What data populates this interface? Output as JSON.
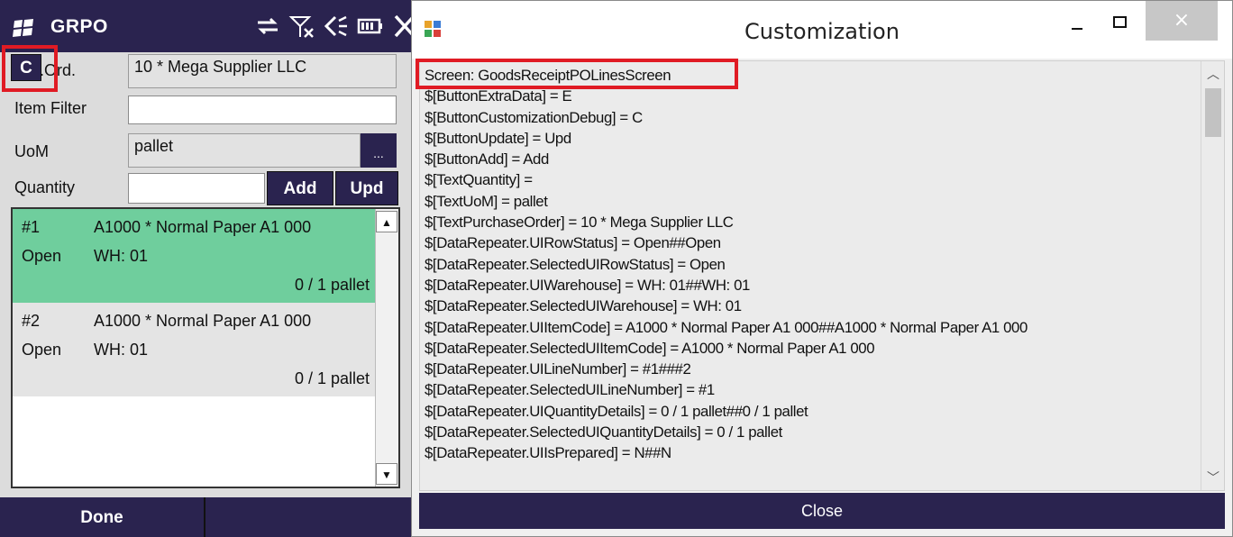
{
  "mobile": {
    "title": "GRPO",
    "debug_button": "C",
    "fields": {
      "purchase_order": {
        "label_visible": "n.Ord.",
        "value": "10 * Mega Supplier LLC"
      },
      "item_filter": {
        "label": "Item Filter",
        "value": ""
      },
      "uom": {
        "label": "UoM",
        "value": "pallet",
        "button": "..."
      },
      "quantity": {
        "label": "Quantity",
        "value": ""
      }
    },
    "buttons": {
      "add": "Add",
      "upd": "Upd",
      "done": "Done"
    },
    "rows": [
      {
        "num": "#1",
        "item": "A1000 * Normal Paper A1 000",
        "status": "Open",
        "wh": "WH: 01",
        "qty": "0 / 1 pallet",
        "selected": true
      },
      {
        "num": "#2",
        "item": "A1000 * Normal Paper A1 000",
        "status": "Open",
        "wh": "WH: 01",
        "qty": "0 / 1 pallet",
        "selected": false
      }
    ],
    "status_icons": [
      "sync-icon",
      "signal-off-icon",
      "volume-icon",
      "battery-icon",
      "close-icon"
    ]
  },
  "dialog": {
    "title": "Customization",
    "close_glyph": "×",
    "close_button": "Close",
    "lines": [
      "Screen: GoodsReceiptPOLinesScreen",
      "$[ButtonExtraData] = E",
      "$[ButtonCustomizationDebug] = C",
      "$[ButtonUpdate] = Upd",
      "$[ButtonAdd] = Add",
      "$[TextQuantity] =",
      "$[TextUoM] = pallet",
      "$[TextPurchaseOrder] = 10 * Mega Supplier LLC",
      "$[DataRepeater.UIRowStatus] = Open##Open",
      "$[DataRepeater.SelectedUIRowStatus] = Open",
      "$[DataRepeater.UIWarehouse] = WH: 01##WH: 01",
      "$[DataRepeater.SelectedUIWarehouse] = WH: 01",
      "$[DataRepeater.UIItemCode] = A1000 * Normal Paper A1 000##A1000 * Normal Paper A1 000",
      "$[DataRepeater.SelectedUIItemCode] = A1000 * Normal Paper A1 000",
      "$[DataRepeater.UILineNumber] = #1###2",
      "$[DataRepeater.SelectedUILineNumber] = #1",
      "$[DataRepeater.UIQuantityDetails] = 0 / 1 pallet##0 / 1 pallet",
      "$[DataRepeater.SelectedUIQuantityDetails] = 0 / 1 pallet",
      "$[DataRepeater.UIIsPrepared] = N##N"
    ]
  },
  "colors": {
    "dark_navy": "#2a234f",
    "selected_row": "#6fce9d",
    "highlight_red": "#e01b24"
  }
}
